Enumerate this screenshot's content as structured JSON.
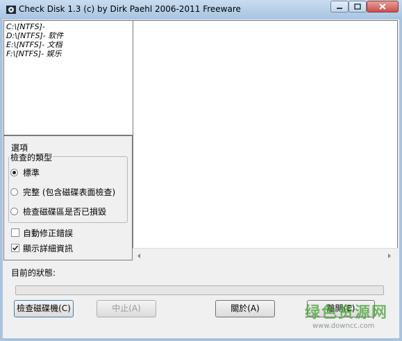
{
  "window": {
    "title": "Check Disk 1.3  (c) by Dirk Paehl  2006-2011 Freeware"
  },
  "drives": [
    {
      "label": "C:\\[NTFS]-"
    },
    {
      "label": "D:\\[NTFS]- 软件"
    },
    {
      "label": "E:\\[NTFS]- 文档"
    },
    {
      "label": "F:\\[NTFS]- 娱乐"
    }
  ],
  "options": {
    "title": "選項",
    "group_label": "檢查的類型",
    "check_types": [
      {
        "label": "標準",
        "selected": true
      },
      {
        "label": "完整 (包含磁碟表面檢查)",
        "selected": false
      },
      {
        "label": "檢查磁碟區是否已損毀",
        "selected": false
      }
    ],
    "auto_fix": {
      "label": "自動修正錯誤",
      "checked": false
    },
    "show_details": {
      "label": "顯示詳細資訊",
      "checked": true
    }
  },
  "status": {
    "label": "目前的狀態:",
    "progress": 0
  },
  "buttons": {
    "check": "檢查磁碟機(C)",
    "stop": "中止(A)",
    "about": "關於(A)",
    "exit": "離開(E)"
  },
  "watermark": {
    "logo": "绿色资源网",
    "url": "www.downcc.com"
  },
  "colors": {
    "accent": "#3c7fb1",
    "watermark": "#4aa43a"
  }
}
